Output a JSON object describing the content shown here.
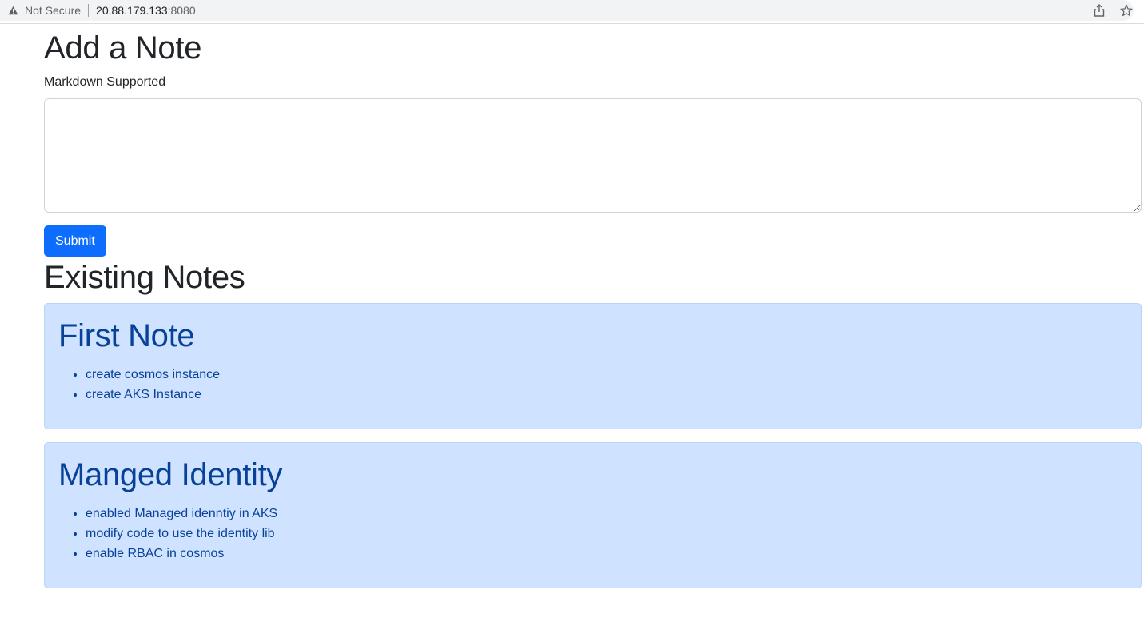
{
  "browser": {
    "security_label": "Not Secure",
    "url_host": "20.88.179.133",
    "url_port": ":8080",
    "icons": [
      "warning-icon",
      "share-icon",
      "star-icon"
    ]
  },
  "form": {
    "title": "Add a Note",
    "label": "Markdown Supported",
    "textarea_value": "",
    "submit_label": "Submit"
  },
  "existing": {
    "title": "Existing Notes",
    "notes": [
      {
        "title": "First Note",
        "items": [
          "create cosmos instance",
          "create AKS Instance"
        ]
      },
      {
        "title": "Manged Identity",
        "items": [
          "enabled Managed idenntiy in AKS",
          "modify code to use the identity lib",
          "enable RBAC in cosmos"
        ]
      }
    ]
  },
  "colors": {
    "primary": "#0d6efd",
    "card_bg": "#cfe2ff",
    "card_text": "#084298"
  }
}
